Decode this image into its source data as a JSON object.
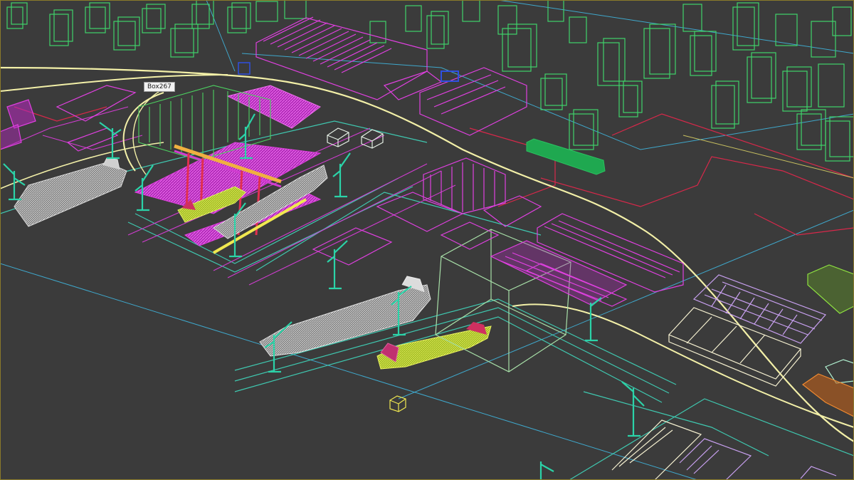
{
  "viewport": {
    "object_tooltip": "Box267",
    "colors": {
      "background": "#3b3b3b",
      "buildings_green": "#3fd26a",
      "structures_magenta": "#e040e0",
      "cranes_teal": "#2bd3a8",
      "roads_yellow": "#f3f0a8",
      "ship_gray": "#cfcfcf",
      "ship_yellow": "#c8e03a",
      "lines_cyan": "#45b6d6",
      "zones_red": "#d8284a",
      "selection_box": "#a8e0a8",
      "warehouse_white": "#f5f0d0",
      "truck_green": "#1fa850",
      "lavender": "#c8a0f0",
      "orange": "#e07a20"
    },
    "icons": [
      "gantry-crane-icon",
      "cargo-ship-icon",
      "dummy-helper-icon"
    ]
  }
}
